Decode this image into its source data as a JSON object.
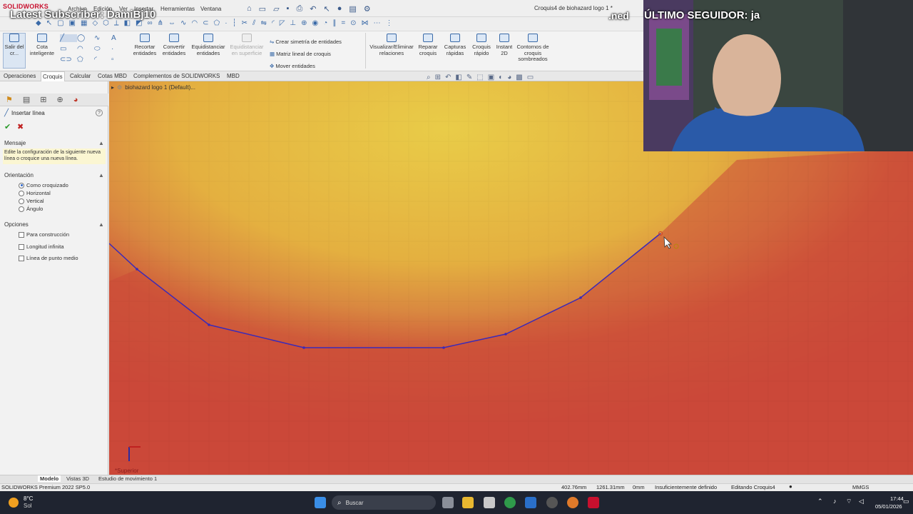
{
  "overlay": {
    "latest_subscriber": "Latest Subscriber: DamiBj10",
    "ultimo_seguidor": "ÚLTIMO SEGUIDOR: ja",
    "ned": ".ned"
  },
  "app": {
    "brand": "SOLIDWORKS",
    "title": "Croquis4 de biohazard logo 1 *",
    "menus": [
      "Archivo",
      "Edición",
      "Ver",
      "Insertar",
      "Herramientas",
      "Ventana"
    ]
  },
  "ribbon": {
    "salir": "Salir del cr...",
    "cota": "Cota inteligente",
    "recortar": "Recortar entidades",
    "convertir": "Convertir entidades",
    "equidistanciar": "Equidistanciar entidades",
    "equidistanciar_sup": "Equidistanciar en superficie",
    "simetria": "Crear simetría de entidades",
    "matriz": "Matriz lineal de croquis",
    "mover": "Mover entidades",
    "visualizar": "Visualizar/Eliminar relaciones",
    "reparar": "Reparar croquis",
    "capturas": "Capturas rápidas",
    "croquis_rapido": "Croquis rápido",
    "instant2d": "Instant 2D",
    "contornos": "Contornos de croquis sombreados"
  },
  "tabs": [
    "Operaciones",
    "Croquis",
    "Calcular",
    "Cotas MBD",
    "Complementos de SOLIDWORKS",
    "MBD"
  ],
  "active_tab": "Croquis",
  "tree": {
    "item": "biohazard logo 1 (Default)..."
  },
  "panel": {
    "title": "Insertar línea",
    "mensaje_head": "Mensaje",
    "mensaje": "Edite la configuración de la siguiente nueva línea o croquice una nueva línea.",
    "orientacion_head": "Orientación",
    "orientacion": [
      "Como croquizado",
      "Horizontal",
      "Vertical",
      "Ángulo"
    ],
    "opciones_head": "Opciones",
    "opciones": [
      "Para construcción",
      "Longitud infinita",
      "Línea de punto medio"
    ]
  },
  "view": {
    "label": "*Superior"
  },
  "bottom_tabs": [
    "Modelo",
    "Vistas 3D",
    "Estudio de movimiento 1"
  ],
  "status": {
    "product": "SOLIDWORKS Premium 2022 SP5.0",
    "x": "402.76mm",
    "y": "1261.31mm",
    "z": "0mm",
    "state": "Insuficientemente definido",
    "editing": "Editando Croquis4",
    "units": "MMGS"
  },
  "taskbar": {
    "temp": "8°C",
    "weather": "Sol",
    "search": "Buscar",
    "time": "17:44",
    "date": "05/01/2026"
  },
  "colors": {
    "sketch_line": "#3b2ab8",
    "bg_yellow": "#e8c040",
    "bg_red": "#cc4a3a",
    "accent": "#c8102e"
  }
}
